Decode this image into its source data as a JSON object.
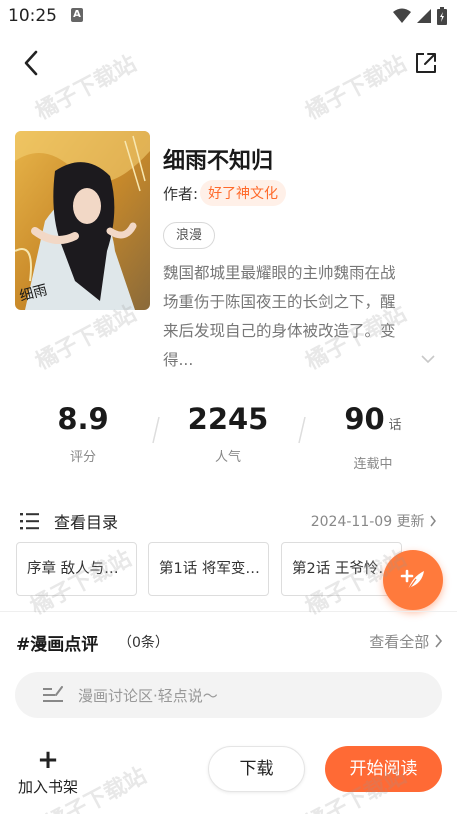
{
  "status_bar": {
    "time": "10:25",
    "notification_letter": "A"
  },
  "comic": {
    "title": "细雨不知归",
    "author_label": "作者:",
    "author_name": "好了神文化",
    "tag": "浪漫",
    "description_lines": [
      "魏国都城里最耀眼的主帅魏雨在战",
      "场重伤于陈国夜王的长剑之下，醒",
      "来后发现自己的身体被改造了。变",
      "得..."
    ]
  },
  "stats": [
    {
      "value": "8.9",
      "unit": "",
      "label": "评分"
    },
    {
      "value": "2245",
      "unit": "",
      "label": "人气"
    },
    {
      "value": "90",
      "unit": "话",
      "label": "连载中"
    }
  ],
  "catalog": {
    "label": "查看目录",
    "update_text": "2024-11-09 更新"
  },
  "chapters": [
    "序章 敌人与…",
    "第1话 将军变…",
    "第2话 王爷怜…"
  ],
  "reviews": {
    "title": "#漫画点评",
    "count": "（0条）",
    "view_all": "查看全部"
  },
  "comment": {
    "placeholder": "漫画讨论区·轻点说～"
  },
  "bottom_bar": {
    "shelf_label": "加入书架",
    "shelf_plus": "+",
    "download_label": "下载",
    "read_label": "开始阅读"
  },
  "watermark_text": "橘子下载站",
  "colors": {
    "accent": "#ff6a35",
    "author_tag_bg": "#fff0e8",
    "author_tag_text": "#ff6a2b"
  },
  "icons": [
    "back-arrow-icon",
    "share-icon",
    "wifi-icon",
    "signal-icon",
    "battery-icon",
    "list-icon",
    "chevron-right-icon",
    "chevron-down-icon",
    "feather-plus-icon",
    "comment-edit-icon",
    "plus-icon"
  ]
}
